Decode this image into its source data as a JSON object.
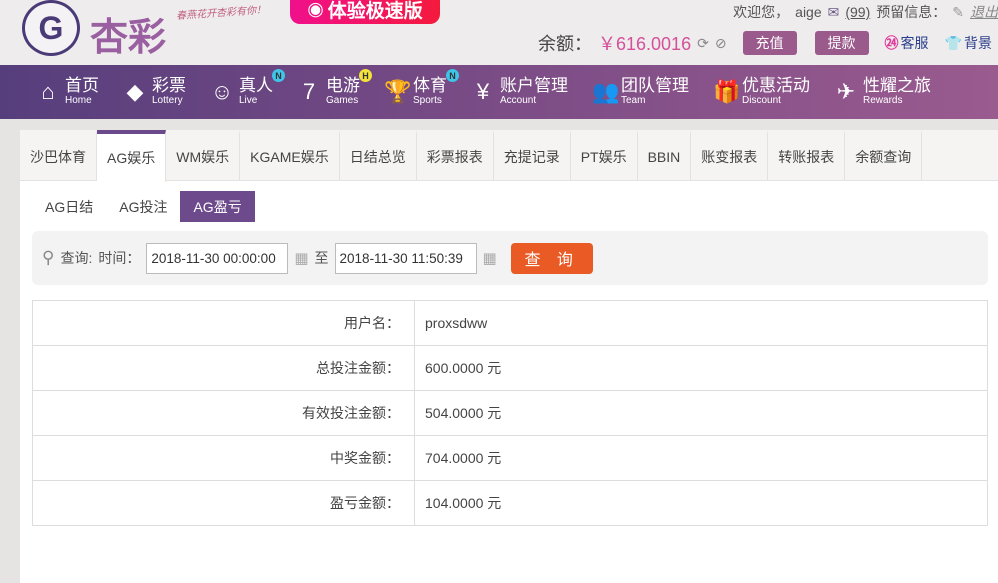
{
  "header": {
    "logo_text": "杏彩",
    "slogan": "春燕花开杏彩有你！",
    "promo": "体验极速版",
    "welcome": "欢迎您，",
    "username": "aige",
    "messages": "(99)",
    "reserved_info": "预留信息：",
    "logout": "退出",
    "balance_label": "余额：",
    "balance": "￥616.0016",
    "deposit": "充值",
    "withdraw": "提款",
    "service": "客服",
    "skin": "背景"
  },
  "nav": [
    {
      "zh": "首页",
      "en": "Home",
      "icon": "⌂"
    },
    {
      "zh": "彩票",
      "en": "Lottery",
      "icon": "◆"
    },
    {
      "zh": "真人",
      "en": "Live",
      "icon": "☺",
      "badge": "N",
      "badge_color": "#3ec5e8"
    },
    {
      "zh": "电游",
      "en": "Games",
      "icon": "7",
      "badge": "H",
      "badge_color": "#f2e23a"
    },
    {
      "zh": "体育",
      "en": "Sports",
      "icon": "🏆",
      "badge": "N",
      "badge_color": "#3ec5e8"
    },
    {
      "zh": "账户管理",
      "en": "Account",
      "icon": "¥"
    },
    {
      "zh": "团队管理",
      "en": "Team",
      "icon": "👥"
    },
    {
      "zh": "优惠活动",
      "en": "Discount",
      "icon": "🎁"
    },
    {
      "zh": "性耀之旅",
      "en": "Rewards",
      "icon": "✈"
    }
  ],
  "tabs": [
    "沙巴体育",
    "AG娱乐",
    "WM娱乐",
    "KGAME娱乐",
    "日结总览",
    "彩票报表",
    "充提记录",
    "PT娱乐",
    "BBIN",
    "账变报表",
    "转账报表",
    "余额查询"
  ],
  "subtabs": [
    "AG日结",
    "AG投注",
    "AG盈亏"
  ],
  "search": {
    "label": "查询:",
    "time_label": "时间：",
    "start": "2018-11-30 00:00:00",
    "to": "至",
    "end": "2018-11-30 11:50:39",
    "button": "查 询"
  },
  "rows": [
    {
      "label": "用户名：",
      "value": "proxsdww"
    },
    {
      "label": "总投注金额：",
      "value": "600.0000 元"
    },
    {
      "label": "有效投注金额：",
      "value": "504.0000 元"
    },
    {
      "label": "中奖金额：",
      "value": "704.0000 元"
    },
    {
      "label": "盈亏金额：",
      "value": "104.0000 元"
    }
  ]
}
